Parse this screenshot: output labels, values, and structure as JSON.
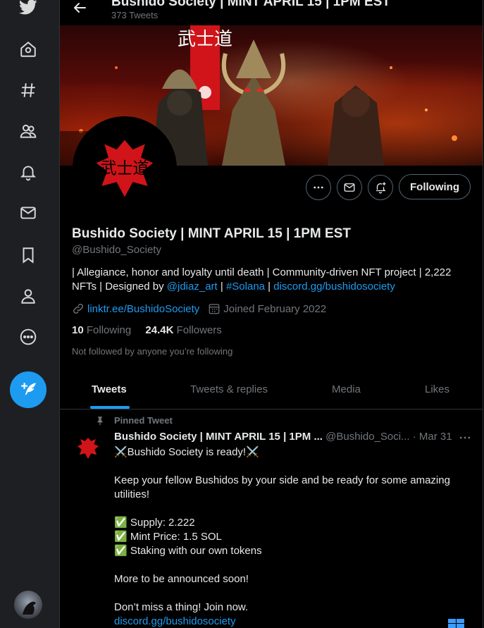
{
  "header": {
    "title": "Bushido Society | MINT APRIL 15 | 1PM EST",
    "tweet_count": "373 Tweets"
  },
  "banner_logo_text": "武士道",
  "profile": {
    "name": "Bushido Society | MINT APRIL 15 | 1PM EST",
    "handle": "@Bushido_Society",
    "bio_text_1": "| Allegiance, honor and loyalty until death | Community-driven NFT project | 2,222 NFTs | Designed by ",
    "bio_mention": "@jdiaz_art",
    "bio_sep_1": " | ",
    "bio_hashtag": "#Solana",
    "bio_sep_2": " | ",
    "bio_link": "discord.gg/bushidosociety",
    "website": "linktr.ee/BushidoSociety",
    "joined": "Joined February 2022",
    "following_count": "10",
    "following_label": "Following",
    "followers_count": "24.4K",
    "followers_label": "Followers",
    "not_followed": "Not followed by anyone you’re following",
    "follow_button": "Following"
  },
  "tabs": [
    "Tweets",
    "Tweets & replies",
    "Media",
    "Likes"
  ],
  "tweet": {
    "pinned_label": "Pinned Tweet",
    "author_name": "Bushido Society | MINT APRIL 15 | 1PM ...",
    "author_handle": "@Bushido_Soci...",
    "date": "· Mar 31",
    "line1": "⚔️Bushido Society is ready!⚔️",
    "line2": "Keep your fellow Bushidos by your side and be ready for some amazing utilities!",
    "line3": "✅ Supply: 2.222",
    "line4": "✅ Mint Price: 1.5 SOL",
    "line5": "✅ Staking with our own tokens",
    "line6": "More to be announced soon!",
    "line7": "Don’t miss a thing! Join now.",
    "link": "discord.gg/bushidosociety"
  },
  "colors": {
    "accent": "#1d9bf0",
    "brand_red": "#d0141a",
    "background": "#000000",
    "sidebar": "#1e1f23"
  }
}
